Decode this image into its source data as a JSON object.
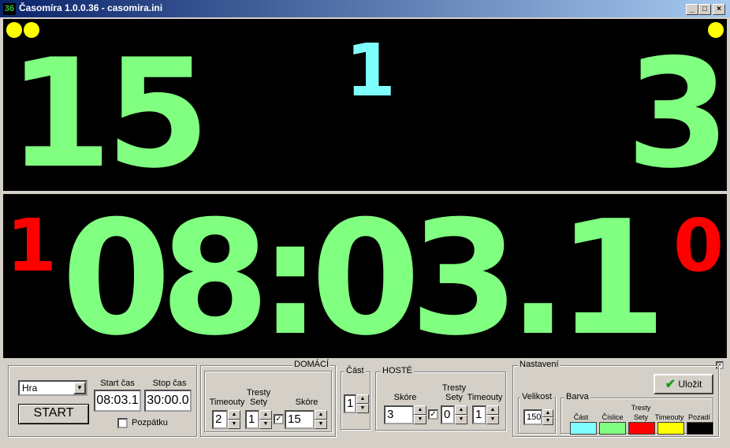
{
  "window": {
    "title": "Časomíra 1.0.0.36 - casomira.ini",
    "icon_text": "36",
    "minimize_glyph": "_",
    "maximize_glyph": "□",
    "close_glyph": "×"
  },
  "scoreboard": {
    "home_score": "15",
    "period": "1",
    "guest_score": "3",
    "time": "08:03.1",
    "home_penalties": "1",
    "guest_penalties": "0",
    "home_timeout_dots": 2,
    "guest_timeout_dots": 1
  },
  "colors": {
    "digits": "#80ff80",
    "period": "#80ffff",
    "penalties": "#ff0000",
    "timeouts": "#ffff00",
    "background": "#000000"
  },
  "controls": {
    "mode_select": "Hra",
    "start_button": "START",
    "start_time_label": "Start čas",
    "start_time": "08:03.1",
    "stop_time_label": "Stop čas",
    "stop_time": "30:00.0",
    "countdown_label": "Pozpátku",
    "countdown_checked": false
  },
  "home": {
    "legend": "DOMÁCÍ",
    "timeouts_label": "Timeouty",
    "timeouts": "2",
    "sets_label_1": "Tresty",
    "sets_label_2": "Sety",
    "sets": "1",
    "sets_checked": true,
    "score_label": "Skóre",
    "score": "15"
  },
  "period_box": {
    "legend": "Část",
    "value": "1"
  },
  "guest": {
    "legend": "HOSTÉ",
    "score_label": "Skóre",
    "score": "3",
    "sets_checked": true,
    "sets_label_1": "Tresty",
    "sets_label_2": "Sety",
    "sets": "0",
    "timeouts_label": "Timeouty",
    "timeouts": "1"
  },
  "settings": {
    "legend": "Nastavení",
    "save_button": "Uložit",
    "size_legend": "Velikost",
    "size": "150",
    "color_legend": "Barva",
    "swatches": [
      {
        "label": "Část",
        "color": "#80ffff"
      },
      {
        "label": "Číslice",
        "color": "#80ff80"
      },
      {
        "label_1": "Tresty",
        "label_2": "Sety",
        "color": "#ff0000"
      },
      {
        "label": "Timeouty",
        "color": "#ffff00"
      },
      {
        "label": "Pozadí",
        "color": "#000000"
      }
    ]
  }
}
